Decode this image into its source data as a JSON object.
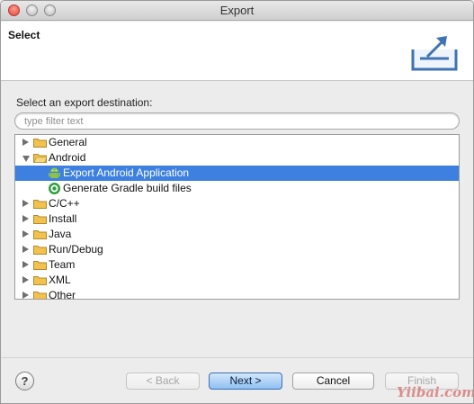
{
  "window": {
    "title": "Export"
  },
  "header": {
    "title": "Select",
    "icon": "export-icon"
  },
  "destination_label": "Select an export destination:",
  "filter": {
    "placeholder": "type filter text",
    "value": ""
  },
  "tree": {
    "items": [
      {
        "label": "General",
        "type": "folder",
        "expanded": false,
        "level": 0
      },
      {
        "label": "Android",
        "type": "folder",
        "expanded": true,
        "level": 0
      },
      {
        "label": "Export Android Application",
        "type": "android-icon",
        "level": 1,
        "selected": true
      },
      {
        "label": "Generate Gradle build files",
        "type": "gradle-icon",
        "level": 1
      },
      {
        "label": "C/C++",
        "type": "folder",
        "expanded": false,
        "level": 0
      },
      {
        "label": "Install",
        "type": "folder",
        "expanded": false,
        "level": 0
      },
      {
        "label": "Java",
        "type": "folder",
        "expanded": false,
        "level": 0
      },
      {
        "label": "Run/Debug",
        "type": "folder",
        "expanded": false,
        "level": 0
      },
      {
        "label": "Team",
        "type": "folder",
        "expanded": false,
        "level": 0
      },
      {
        "label": "XML",
        "type": "folder",
        "expanded": false,
        "level": 0
      },
      {
        "label": "Other",
        "type": "folder",
        "expanded": false,
        "level": 0
      }
    ]
  },
  "buttons": {
    "help": "?",
    "back": "< Back",
    "next": "Next >",
    "cancel": "Cancel",
    "finish": "Finish"
  },
  "watermark": "Yiibai.com",
  "colors": {
    "selection": "#3d80df",
    "folder": "#f2c14e",
    "android": "#8bc34a",
    "gradle": "#2e9e3e"
  }
}
